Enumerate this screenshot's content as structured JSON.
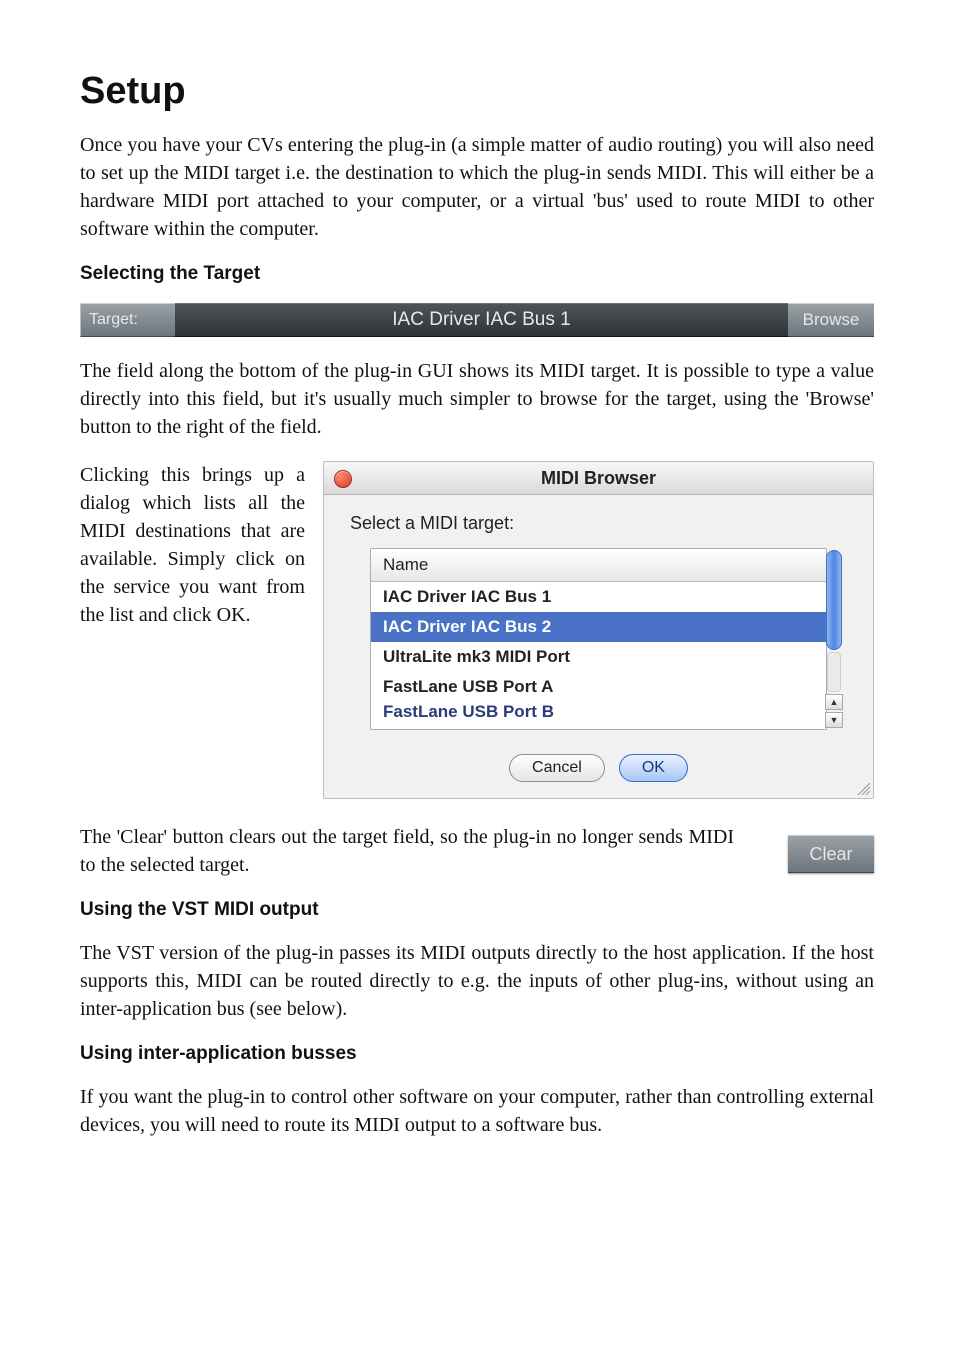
{
  "title": "Setup",
  "intro": "Once you have your CVs entering the plug-in (a simple matter of audio routing) you will also need to set up the MIDI target i.e. the destination to which the plug-in sends MIDI. This will either be a hardware MIDI port attached to your computer, or a virtual 'bus' used to route MIDI to other software within the computer.",
  "sec1_heading": "Selecting the Target",
  "target_bar": {
    "label": "Target:",
    "value": "IAC Driver IAC Bus 1",
    "browse": "Browse"
  },
  "after_bar": "The field along the bottom of the plug-in GUI shows its MIDI target. It is possible to type a value directly into this field, but it's usually much simpler to browse for the target, using the 'Browse' button to the right of the field.",
  "left_note": "Clicking this brings up a dialog which lists all the MIDI destinations that are available. Simply click on the service you want from the list and click OK.",
  "midi_browser": {
    "title": "MIDI Browser",
    "prompt": "Select a MIDI target:",
    "header": "Name",
    "items": [
      "IAC Driver IAC Bus 1",
      "IAC Driver IAC Bus 2",
      "UltraLite mk3 MIDI Port",
      "FastLane USB Port A",
      "FastLane USB Port B"
    ],
    "selected_index": 1,
    "cancel": "Cancel",
    "ok": "OK"
  },
  "clear_text": "The 'Clear' button clears out the target field, so the plug-in no longer sends MIDI to the selected target.",
  "clear_label": "Clear",
  "sec2_heading": "Using the VST MIDI output",
  "sec2_body": "The VST version of the plug-in passes its MIDI outputs directly to the host application. If the host supports this, MIDI can be routed directly to e.g. the inputs of other plug-ins, without using an inter-application bus (see below).",
  "sec3_heading": "Using inter-application busses",
  "sec3_body": "If you want the plug-in to control other software on your computer, rather than controlling external devices, you will need to route its MIDI output to a software bus."
}
